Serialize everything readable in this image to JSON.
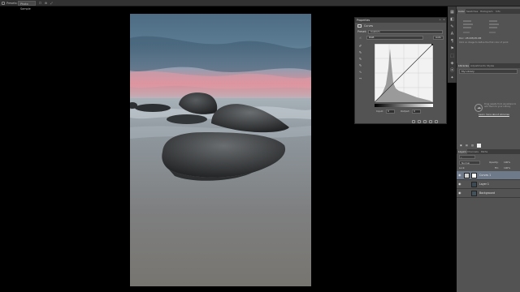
{
  "options_bar": {
    "preset_label": "Presets:",
    "preset_value": "Photo Sample",
    "items": [
      "☐",
      "⚙",
      "⤢"
    ]
  },
  "properties": {
    "tab_label": "Properties",
    "panel_name": "Curves",
    "preset_label": "Preset:",
    "preset_value": "Custom",
    "channel_value": "RGB",
    "auto_label": "Auto",
    "input_label": "Input:",
    "input_value": "0",
    "output_label": "Output:",
    "output_value": "0",
    "tools": [
      "✐",
      "✎",
      "✎",
      "✎",
      "∿",
      "⤳"
    ]
  },
  "iconstrip": {
    "icons": [
      "▦",
      "◧",
      "✎",
      "A",
      "¶",
      "⚑",
      "⬚",
      "◈",
      "⦿",
      "✦"
    ]
  },
  "right_panels": {
    "color_tabs": [
      "Color",
      "Swatches",
      "Histogram",
      "Info"
    ],
    "color_info_lines": [
      "Doc: 28.0M/28.0M",
      "Click on image to define the first color of point"
    ],
    "library_tabs": [
      "Libraries",
      "Adjustments",
      "Styles"
    ],
    "library_name": "My Library",
    "library_message": "Drag assets from anywhere to add them to your Library",
    "library_link": "Learn more about Libraries",
    "layers_tabs": [
      "Layers",
      "Channels",
      "Paths"
    ],
    "blend_mode": "Normal",
    "opacity_label": "Opacity:",
    "opacity_value": "100%",
    "lock_label": "Lock:",
    "fill_label": "Fill:",
    "fill_value": "100%",
    "layers": [
      {
        "name": "Curves 1",
        "selected": true
      },
      {
        "name": "Layer 1",
        "selected": false
      },
      {
        "name": "Background",
        "selected": false
      }
    ]
  },
  "colors": {
    "accent": "#6e7a8a",
    "panel_bg": "#535353",
    "chrome_bg": "#323232"
  }
}
